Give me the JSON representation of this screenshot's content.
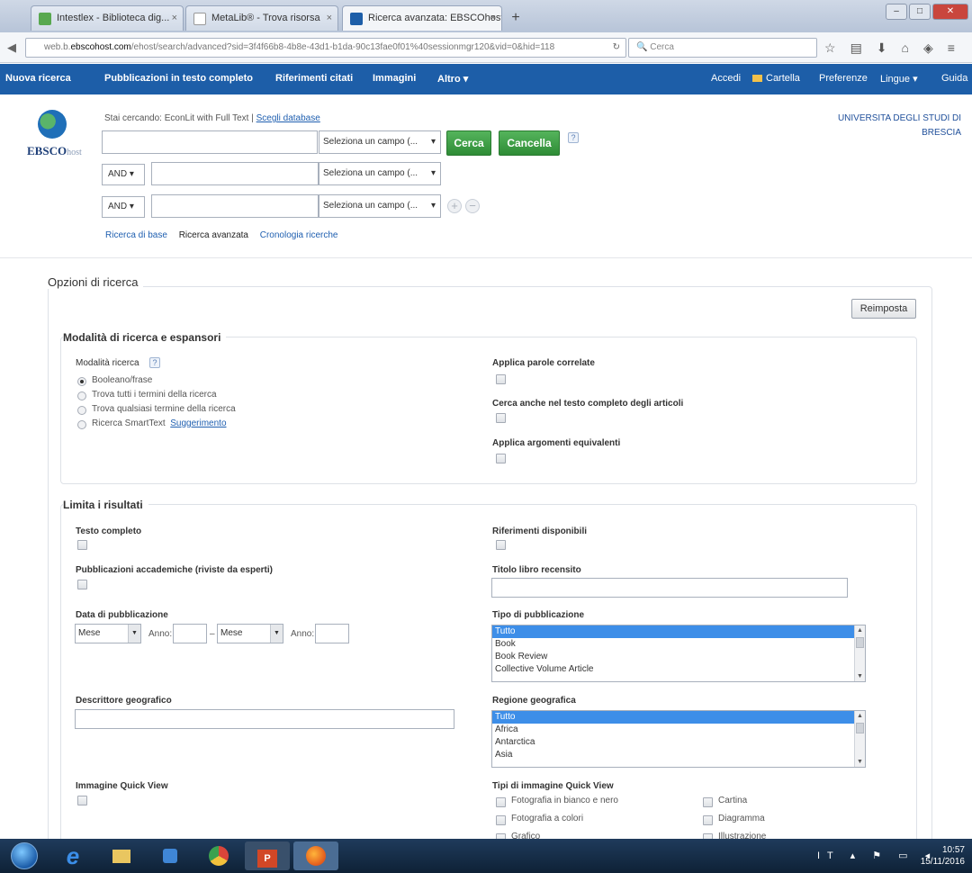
{
  "browser": {
    "tabs": [
      {
        "label": "Intestlex - Biblioteca dig...",
        "active": false,
        "icon_color": "#58a84f"
      },
      {
        "label": "MetaLib® - Trova risorsa",
        "active": false,
        "icon_color": "#ffffff"
      },
      {
        "label": "Ricerca avanzata: EBSCOhost",
        "active": true,
        "icon_color": "#1d5ea8"
      }
    ],
    "url_prefix": "web.b.",
    "url_domain": "ebscohost.com",
    "url_rest": "/ehost/search/advanced?sid=3f4f66b8-4b8e-43d1-b1da-90c13fae0f01%40sessionmgr120&vid=0&hid=118",
    "search_placeholder": "Cerca"
  },
  "ebsco_nav": {
    "left": [
      "Nuova ricerca",
      "Pubblicazioni in testo completo",
      "Riferimenti citati",
      "Immagini",
      "Altro ▾"
    ],
    "right": [
      "Accedi",
      "Cartella",
      "Preferenze",
      "Lingue ▾",
      "Guida"
    ]
  },
  "header": {
    "logo_text": "EBSCO",
    "logo_suffix": "host",
    "searching_prefix": "Stai cercando:",
    "database": "EconLit with Full Text",
    "choose_db": "Scegli database",
    "institution": "UNIVERSITA DEGLI STUDI DI BRESCIA"
  },
  "search": {
    "field_select": "Seleziona un campo (...",
    "bool": "AND",
    "search_btn": "Cerca",
    "clear_btn": "Cancella",
    "help": "?",
    "links": [
      "Ricerca di base",
      "Ricerca avanzata",
      "Cronologia ricerche"
    ]
  },
  "options": {
    "title": "Opzioni di ricerca",
    "reset": "Reimposta",
    "modes_title": "Modalità di ricerca e espansori",
    "mode_label": "Modalità ricerca",
    "modes": [
      "Booleano/frase",
      "Trova tutti i termini della ricerca",
      "Trova qualsiasi termine della ricerca",
      "Ricerca SmartText"
    ],
    "suggestions_link": "Suggerimento",
    "expanders": [
      "Applica parole correlate",
      "Cerca anche nel testo completo degli articoli",
      "Applica argomenti equivalenti"
    ]
  },
  "limits": {
    "title": "Limita i risultati",
    "full_text": "Testo completo",
    "refs_available": "Riferimenti disponibili",
    "peer_reviewed": "Pubblicazioni accademiche (riviste da esperti)",
    "book_title": "Titolo libro recensito",
    "pub_date": "Data di pubblicazione",
    "month": "Mese",
    "year": "Anno:",
    "dash": "–",
    "pub_type": "Tipo di pubblicazione",
    "pub_type_options": [
      "Tutto",
      "Book",
      "Book Review",
      "Collective Volume Article"
    ],
    "geo_descriptor": "Descrittore geografico",
    "geo_region": "Regione geografica",
    "geo_region_options": [
      "Tutto",
      "Africa",
      "Antarctica",
      "Asia"
    ],
    "quick_view": "Immagine Quick View",
    "quick_view_types": "Tipi di immagine Quick View",
    "qv_left": [
      "Fotografia in bianco e nero",
      "Fotografia a colori",
      "Grafico"
    ],
    "qv_right": [
      "Cartina",
      "Diagramma",
      "Illustrazione"
    ]
  },
  "taskbar": {
    "lang": "IT",
    "time": "10:57",
    "date": "15/11/2016"
  }
}
